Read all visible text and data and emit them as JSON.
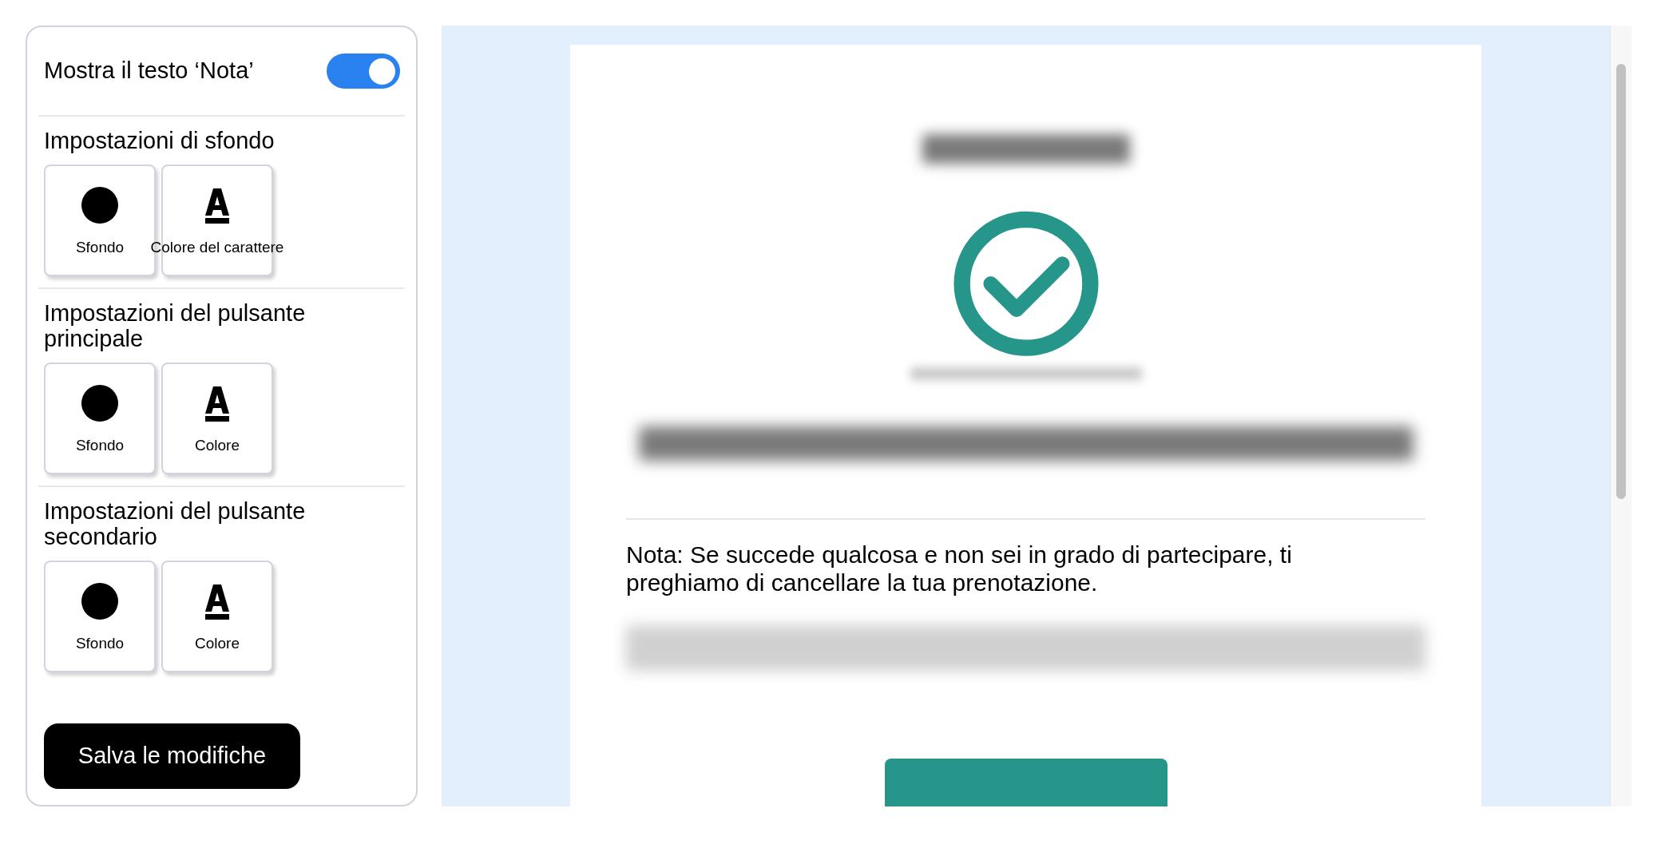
{
  "settings": {
    "note_toggle": {
      "label": "Mostra il testo ‘Nota’",
      "on": true
    },
    "sections": [
      {
        "title": "Impostazioni di sfondo",
        "swatches": [
          {
            "kind": "fill",
            "label": "Sfondo",
            "color": "#000000"
          },
          {
            "kind": "text",
            "label": "Colore del carattere",
            "color": "#000000"
          }
        ]
      },
      {
        "title": "Impostazioni del pulsante principale",
        "swatches": [
          {
            "kind": "fill",
            "label": "Sfondo",
            "color": "#000000"
          },
          {
            "kind": "text",
            "label": "Colore",
            "color": "#000000"
          }
        ]
      },
      {
        "title": "Impostazioni del pulsante secondario",
        "swatches": [
          {
            "kind": "fill",
            "label": "Sfondo",
            "color": "#000000"
          },
          {
            "kind": "text",
            "label": "Colore",
            "color": "#000000"
          }
        ]
      }
    ],
    "save_button": "Salva le modifiche"
  },
  "preview": {
    "note": "Nota: Se succede qualcosa e non sei in grado di partecipare, ti preghiamo di cancellare la tua prenotazione."
  }
}
